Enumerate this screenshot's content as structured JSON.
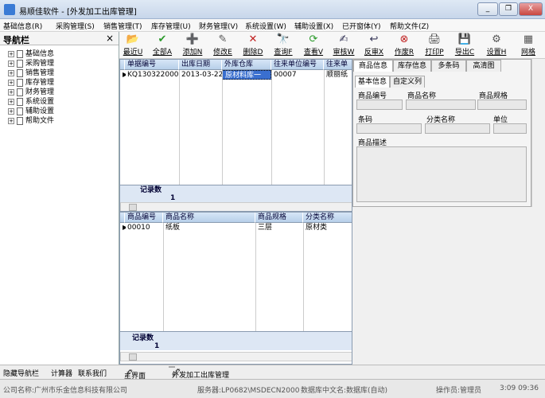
{
  "window": {
    "title": "易顺佳软件 - [外发加工出库管理]",
    "min": "_",
    "restore": "❐",
    "close": "X"
  },
  "menu": [
    "基础信息(R)",
    "采购管理(S)",
    "销售管理(T)",
    "库存管理(U)",
    "财务管理(V)",
    "系统设置(W)",
    "辅助设置(X)",
    "已开窗体(Y)",
    "帮助文件(Z)"
  ],
  "nav": {
    "title": "导航栏",
    "close": "×",
    "items": [
      "基础信息",
      "采购管理",
      "销售管理",
      "库存管理",
      "财务管理",
      "系统设置",
      "辅助设置",
      "帮助文件"
    ]
  },
  "toolbar": [
    {
      "icon": "📂",
      "label": "最近U"
    },
    {
      "icon": "✔",
      "label": "全部A"
    },
    {
      "icon": "➕",
      "label": "添加N"
    },
    {
      "icon": "✎",
      "label": "修改E"
    },
    {
      "icon": "✕",
      "label": "删除D"
    },
    {
      "icon": "🔭",
      "label": "查询F"
    },
    {
      "icon": "⟳",
      "label": "查看V"
    },
    {
      "icon": "✍",
      "label": "审核W"
    },
    {
      "icon": "↩",
      "label": "反审X"
    },
    {
      "icon": "⊗",
      "label": "作废R"
    },
    {
      "icon": "🖨",
      "label": "打印P"
    },
    {
      "icon": "💾",
      "label": "导出C"
    },
    {
      "icon": "⚙",
      "label": "设置H"
    },
    {
      "icon": "▦",
      "label": "网格"
    }
  ],
  "master": {
    "columns": [
      "单据编号",
      "出库日期",
      "外库仓库",
      "往来单位编号",
      "往来单"
    ],
    "row": [
      "KQ1303220001",
      "2013-03-22",
      "原材料库一",
      "00007",
      "顺丽纸"
    ],
    "footer_label": "记录数",
    "footer_count": "1"
  },
  "detail": {
    "columns": [
      "商品编号",
      "商品名称",
      "商品规格",
      "分类名称"
    ],
    "row": [
      "00010",
      "纸板",
      "三层",
      "原材类"
    ],
    "footer_label": "记录数",
    "footer_count": "1"
  },
  "panel": {
    "tabs": [
      "商品信息",
      "库存信息",
      "多条码",
      "高清图"
    ],
    "subtabs": [
      "基本信息",
      "自定义列"
    ],
    "fields": [
      "商品编号",
      "商品名称",
      "商品规格",
      "条码",
      "分类名称",
      "单位",
      "商品描述"
    ]
  },
  "bottom_left": [
    "隐藏导航栏",
    "计算器",
    "联系我们"
  ],
  "doc_tabs": [
    "主界面",
    "外发加工出库管理"
  ],
  "status": {
    "company": "公司名称:广州市乐金信息科技有限公司",
    "server": "服务器:LP0682\\MSDECN2000",
    "db": "数据库中文名:数据库(自动)",
    "operator": "操作员:管理员",
    "time": "3:09 09:36"
  }
}
